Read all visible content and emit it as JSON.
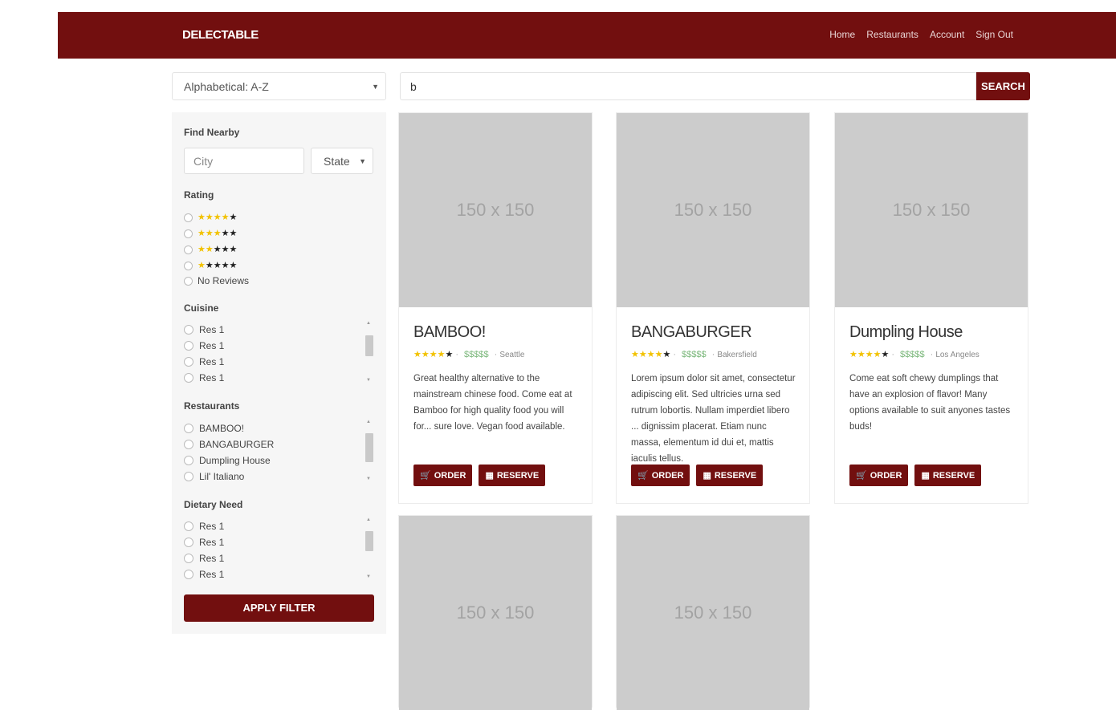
{
  "nav": {
    "brand": "DELECTABLE",
    "links": [
      "Home",
      "Restaurants",
      "Account",
      "Sign Out"
    ]
  },
  "sort": {
    "selected": "Alphabetical: A-Z"
  },
  "search": {
    "value": "b",
    "button_label": "SEARCH"
  },
  "filters": {
    "find_nearby_label": "Find Nearby",
    "city_placeholder": "City",
    "state_selected": "State",
    "rating_label": "Rating",
    "rating_options": [
      {
        "filled": 4,
        "empty": 1
      },
      {
        "filled": 3,
        "empty": 2
      },
      {
        "filled": 2,
        "empty": 3
      },
      {
        "filled": 1,
        "empty": 4
      }
    ],
    "no_reviews_label": "No Reviews",
    "cuisine_label": "Cuisine",
    "cuisine_items": [
      "Res 1",
      "Res 1",
      "Res 1",
      "Res 1"
    ],
    "restaurants_label": "Restaurants",
    "restaurant_items": [
      "BAMBOO!",
      "BANGABURGER",
      "Dumpling House",
      "Lil' Italiano"
    ],
    "dietary_label": "Dietary Need",
    "dietary_items": [
      "Res 1",
      "Res 1",
      "Res 1",
      "Res 1"
    ],
    "apply_label": "APPLY FILTER"
  },
  "placeholder_image_text": "150 x 150",
  "cards": [
    {
      "name": "BAMBOO!",
      "rating": 4,
      "price": "$$$$$",
      "city": "Seattle",
      "description": "Great healthy alternative to the mainstream chinese food. Come eat at Bamboo for high quality food you will for... sure love. Vegan food available.",
      "order_label": "ORDER",
      "reserve_label": "RESERVE"
    },
    {
      "name": "BANGABURGER",
      "rating": 4,
      "price": "$$$$$",
      "city": "Bakersfield",
      "description": "Lorem ipsum dolor sit amet, consectetur adipiscing elit. Sed ultricies urna sed rutrum lobortis. Nullam imperdiet libero ... dignissim placerat. Etiam nunc massa, elementum id dui et, mattis iaculis tellus.",
      "order_label": "ORDER",
      "reserve_label": "RESERVE"
    },
    {
      "name": "Dumpling House",
      "rating": 4,
      "price": "$$$$$",
      "city": "Los Angeles",
      "description": "Come eat soft chewy dumplings that have an explosion of flavor! Many options available to suit anyones tastes buds!",
      "order_label": "ORDER",
      "reserve_label": "RESERVE"
    }
  ],
  "colors": {
    "brand": "#720f0f",
    "star": "#f2c200",
    "price": "#7cb87c"
  }
}
